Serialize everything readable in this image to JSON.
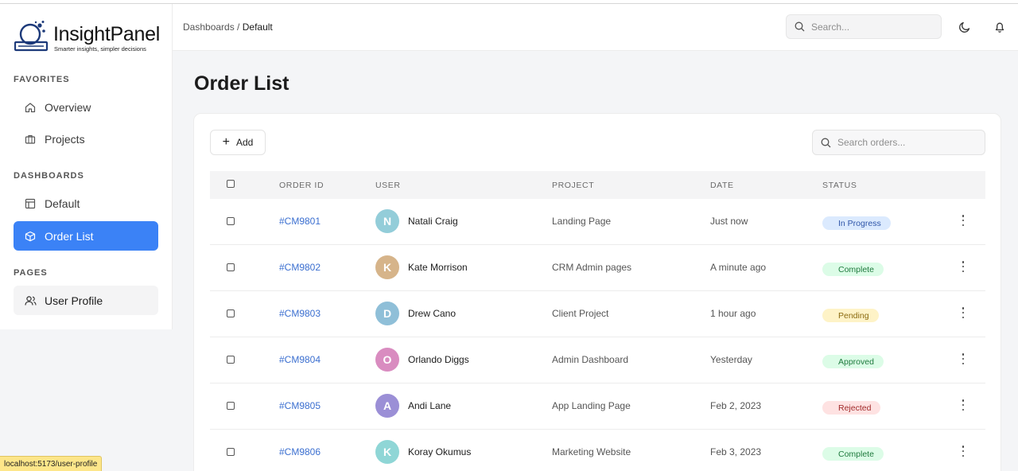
{
  "brand": {
    "name": "InsightPanel",
    "tagline": "Smarter insights, simpler decisions",
    "accent": "#3b82f6"
  },
  "sidebar": {
    "sections": [
      {
        "title": "FAVORITES",
        "items": [
          {
            "label": "Overview",
            "icon": "home-icon"
          },
          {
            "label": "Projects",
            "icon": "briefcase-icon"
          }
        ]
      },
      {
        "title": "DASHBOARDS",
        "items": [
          {
            "label": "Default",
            "icon": "layout-icon"
          },
          {
            "label": "Order List",
            "icon": "box-icon",
            "active": true
          }
        ]
      },
      {
        "title": "PAGES",
        "items": [
          {
            "label": "User Profile",
            "icon": "users-icon",
            "hovered": true
          }
        ]
      }
    ]
  },
  "header": {
    "breadcrumb": {
      "parent": "Dashboards",
      "separator": " / ",
      "current": "Default"
    },
    "search_placeholder": "Search...",
    "icons": [
      "moon-icon",
      "bell-icon"
    ]
  },
  "main": {
    "title": "Order List",
    "add_label": "Add",
    "search_placeholder": "Search orders...",
    "columns": [
      "ORDER ID",
      "USER",
      "PROJECT",
      "DATE",
      "STATUS"
    ],
    "rows": [
      {
        "order_id": "#CM9801",
        "initial": "N",
        "user": "Natali Craig",
        "project": "Landing Page",
        "date": "Just now",
        "status": "In Progress",
        "avatar_color": "#93cdd9",
        "status_bg": "#dbeafe",
        "status_fg": "#2e55a8"
      },
      {
        "order_id": "#CM9802",
        "initial": "K",
        "user": "Kate Morrison",
        "project": "CRM Admin pages",
        "date": "A minute ago",
        "status": "Complete",
        "avatar_color": "#d6b48a",
        "status_bg": "#dcfce7",
        "status_fg": "#1f7a3e"
      },
      {
        "order_id": "#CM9803",
        "initial": "D",
        "user": "Drew Cano",
        "project": "Client Project",
        "date": "1 hour ago",
        "status": "Pending",
        "avatar_color": "#8fbfd8",
        "status_bg": "#fef3c7",
        "status_fg": "#8a6a10"
      },
      {
        "order_id": "#CM9804",
        "initial": "O",
        "user": "Orlando Diggs",
        "project": "Admin Dashboard",
        "date": "Yesterday",
        "status": "Approved",
        "avatar_color": "#d98cc0",
        "status_bg": "#dcfce7",
        "status_fg": "#1f7a3e"
      },
      {
        "order_id": "#CM9805",
        "initial": "A",
        "user": "Andi Lane",
        "project": "App Landing Page",
        "date": "Feb 2, 2023",
        "status": "Rejected",
        "avatar_color": "#9b8fd6",
        "status_bg": "#fee2e2",
        "status_fg": "#a12b2b"
      },
      {
        "order_id": "#CM9806",
        "initial": "K",
        "user": "Koray Okumus",
        "project": "Marketing Website",
        "date": "Feb 3, 2023",
        "status": "Complete",
        "avatar_color": "#8fd6d6",
        "status_bg": "#dcfce7",
        "status_fg": "#1f7a3e"
      }
    ]
  },
  "statusbar": {
    "url": "localhost:5173/user-profile"
  }
}
